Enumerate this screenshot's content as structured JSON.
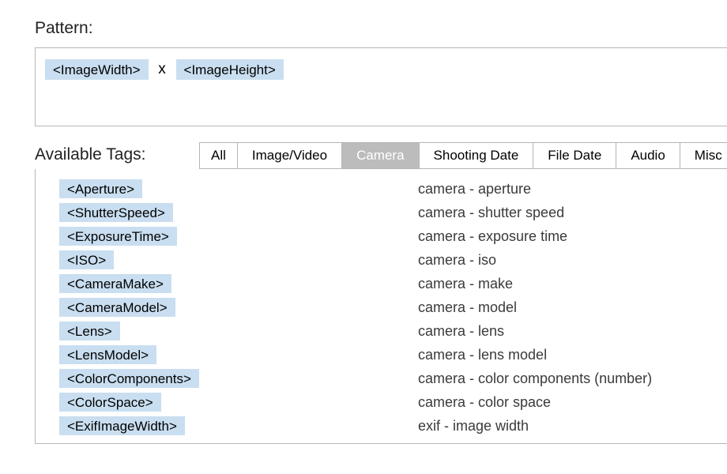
{
  "labels": {
    "pattern": "Pattern:",
    "available": "Available Tags:"
  },
  "pattern": {
    "tokens": [
      "<ImageWidth>",
      "<ImageHeight>"
    ],
    "separator": "x"
  },
  "tabs": [
    {
      "label": "All"
    },
    {
      "label": "Image/Video"
    },
    {
      "label": "Camera",
      "selected": true
    },
    {
      "label": "Shooting Date"
    },
    {
      "label": "File Date"
    },
    {
      "label": "Audio"
    },
    {
      "label": "Misc"
    }
  ],
  "tags": [
    {
      "tag": "<Aperture>",
      "desc": "camera - aperture"
    },
    {
      "tag": "<ShutterSpeed>",
      "desc": "camera - shutter speed"
    },
    {
      "tag": "<ExposureTime>",
      "desc": "camera - exposure time"
    },
    {
      "tag": "<ISO>",
      "desc": "camera - iso"
    },
    {
      "tag": "<CameraMake>",
      "desc": "camera - make"
    },
    {
      "tag": "<CameraModel>",
      "desc": "camera - model"
    },
    {
      "tag": "<Lens>",
      "desc": "camera - lens"
    },
    {
      "tag": "<LensModel>",
      "desc": "camera - lens model"
    },
    {
      "tag": "<ColorComponents>",
      "desc": "camera - color components (number)"
    },
    {
      "tag": "<ColorSpace>",
      "desc": "camera - color space"
    },
    {
      "tag": "<ExifImageWidth>",
      "desc": "exif - image width"
    }
  ]
}
